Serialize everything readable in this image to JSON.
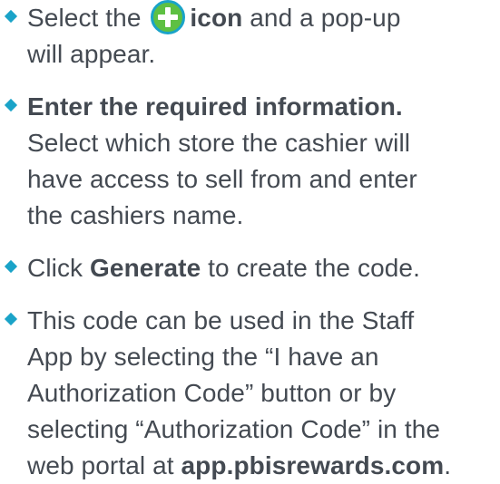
{
  "colors": {
    "bullet": "#1aa3c8",
    "icon_fill": "#5ec043",
    "icon_ring": "#1aa3c8",
    "text": "#444a52"
  },
  "items": [
    {
      "lines": [
        [
          "Select the ",
          "icon:plus-circle-icon",
          " ",
          "b:icon",
          " and a pop-up"
        ],
        [
          "will appear."
        ]
      ]
    },
    {
      "lines": [
        [
          "b:Enter the required information."
        ],
        [
          "Select which store the cashier will"
        ],
        [
          "have access to sell from and enter"
        ],
        [
          "the cashiers name."
        ]
      ]
    },
    {
      "lines": [
        [
          "Click ",
          "b:Generate",
          " to create the code."
        ]
      ]
    },
    {
      "lines": [
        [
          "This code can be used in the Staff"
        ],
        [
          "App by selecting the “I have an"
        ],
        [
          "Authorization Code” button or by"
        ],
        [
          "selecting “Authorization Code” in the"
        ],
        [
          "web portal at ",
          "b:app.pbisrewards.com",
          "."
        ]
      ]
    }
  ]
}
